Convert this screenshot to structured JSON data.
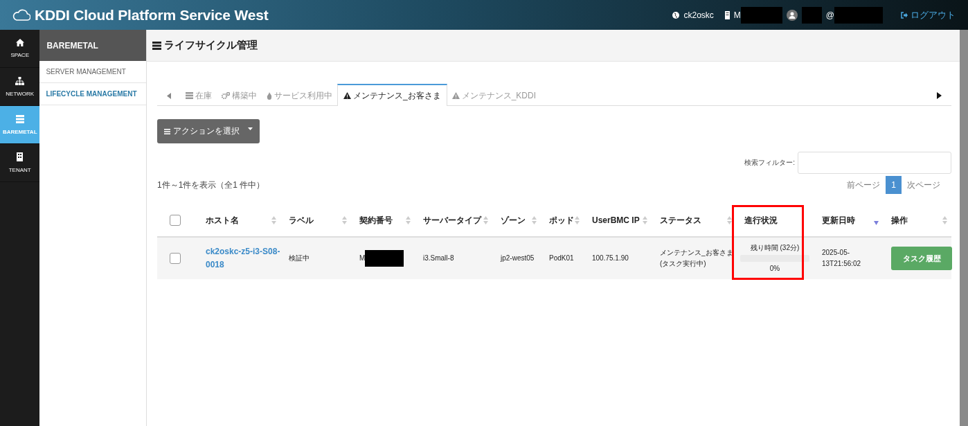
{
  "header": {
    "title": "KDDI Cloud Platform Service West",
    "space": "ck2oskc",
    "tenant_prefix": "M",
    "user_at": "@",
    "logout": "ログアウト"
  },
  "nav": [
    {
      "label": "SPACE",
      "selected": false
    },
    {
      "label": "NETWORK",
      "selected": false
    },
    {
      "label": "BAREMETAL",
      "selected": true
    },
    {
      "label": "TENANT",
      "selected": false
    }
  ],
  "subnav": {
    "title": "BAREMETAL",
    "items": [
      {
        "label": "SERVER MANAGEMENT",
        "selected": false
      },
      {
        "label": "LIFECYCLE MANAGEMENT",
        "selected": true
      }
    ]
  },
  "page_title": "ライフサイクル管理",
  "tabs": [
    {
      "label": "在庫",
      "selected": false
    },
    {
      "label": "構築中",
      "selected": false
    },
    {
      "label": "サービス利用中",
      "selected": false
    },
    {
      "label": "メンテナンス_お客さま",
      "selected": true
    },
    {
      "label": "メンテナンス_KDDI",
      "selected": false
    }
  ],
  "action_button": "アクションを選択",
  "search": {
    "label": "検索フィルター:"
  },
  "info": "1件～1件を表示（全1 件中）",
  "pagination": {
    "prev": "前ページ",
    "pages": [
      {
        "label": "1",
        "selected": true
      }
    ],
    "next": "次ページ"
  },
  "table": {
    "select_all_checked": false,
    "columns": [
      {
        "label": "ホスト名",
        "sortable": true,
        "sorted": false
      },
      {
        "label": "ラベル",
        "sortable": true,
        "sorted": false
      },
      {
        "label": "契約番号",
        "sortable": true,
        "sorted": false
      },
      {
        "label": "サーバータイプ",
        "sortable": true,
        "sorted": false
      },
      {
        "label": "ゾーン",
        "sortable": true,
        "sorted": false
      },
      {
        "label": "ポッド",
        "sortable": true,
        "sorted": false
      },
      {
        "label": "UserBMC IP",
        "sortable": true,
        "sorted": false
      },
      {
        "label": "ステータス",
        "sortable": true,
        "sorted": false
      },
      {
        "label": "進行状況",
        "sortable": false,
        "sorted": false
      },
      {
        "label": "更新日時",
        "sortable": true,
        "sorted": true
      },
      {
        "label": "操作",
        "sortable": true,
        "sorted": false
      }
    ],
    "rows": [
      {
        "checked": false,
        "host": "ck2oskc-z5-i3-S08-0018",
        "label": "検証中",
        "contract_prefix": "M",
        "server_type": "i3.Small-8",
        "zone": "jp2-west05",
        "pod": "PodK01",
        "ip": "100.75.1.90",
        "status": "メンテナンス_お客さま(タスク実行中)",
        "progress": {
          "remaining": "残り時間 (32分)",
          "level": 0,
          "percent": "0%"
        },
        "updated": "2025-05-13T21:56:02",
        "action": "タスク履歴"
      }
    ]
  }
}
